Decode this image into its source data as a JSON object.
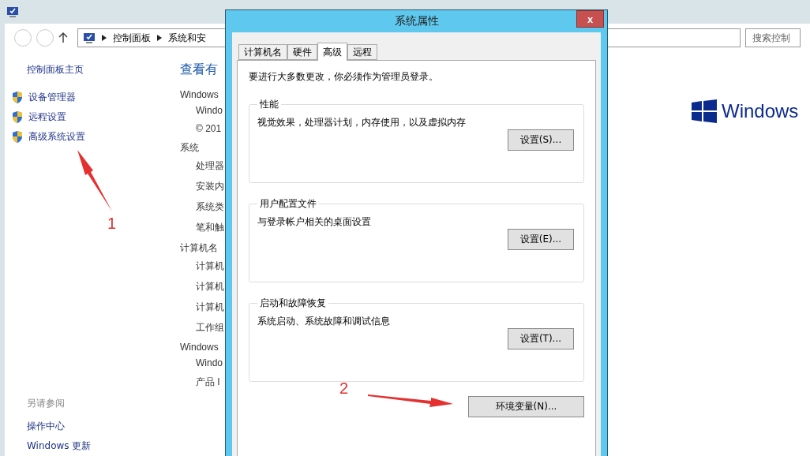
{
  "background_window": {
    "address": [
      "控制面板",
      "系统和安"
    ],
    "search": {
      "placeholder": "搜索控制"
    },
    "sidebar": {
      "home": "控制面板主页",
      "links": [
        {
          "label": "设备管理器"
        },
        {
          "label": "远程设置"
        },
        {
          "label": "高级系统设置"
        }
      ],
      "see_also": "另请参阅",
      "see_also_links": [
        "操作中心",
        "Windows 更新"
      ]
    },
    "content": {
      "heading": "查看有",
      "sections": [
        {
          "title": "Windows",
          "lines": [
            "Windo",
            "© 201"
          ]
        },
        {
          "title": "系统",
          "lines": [
            "处理器",
            "安装内",
            "系统类",
            "笔和触"
          ]
        },
        {
          "title": "计算机名",
          "lines": [
            "计算机",
            "计算机",
            "计算机",
            "工作组"
          ]
        },
        {
          "title": "Windows",
          "lines": [
            "Windo",
            "产品 I"
          ]
        }
      ],
      "logo": "Windows"
    }
  },
  "dialog": {
    "title": "系统属性",
    "close": "x",
    "tabs": [
      {
        "label": "计算机名",
        "selected": false
      },
      {
        "label": "硬件",
        "selected": false
      },
      {
        "label": "高级",
        "selected": true
      },
      {
        "label": "远程",
        "selected": false
      }
    ],
    "notice": "要进行大多数更改，你必须作为管理员登录。",
    "groups": [
      {
        "title": "性能",
        "description": "视觉效果，处理器计划，内存使用，以及虚拟内存",
        "button": "设置(S)..."
      },
      {
        "title": "用户配置文件",
        "description": "与登录帐户相关的桌面设置",
        "button": "设置(E)..."
      },
      {
        "title": "启动和故障恢复",
        "description": "系统启动、系统故障和调试信息",
        "button": "设置(T)..."
      }
    ],
    "env_button": "环境变量(N)..."
  },
  "annotations": [
    {
      "label": "1"
    },
    {
      "label": "2"
    }
  ]
}
